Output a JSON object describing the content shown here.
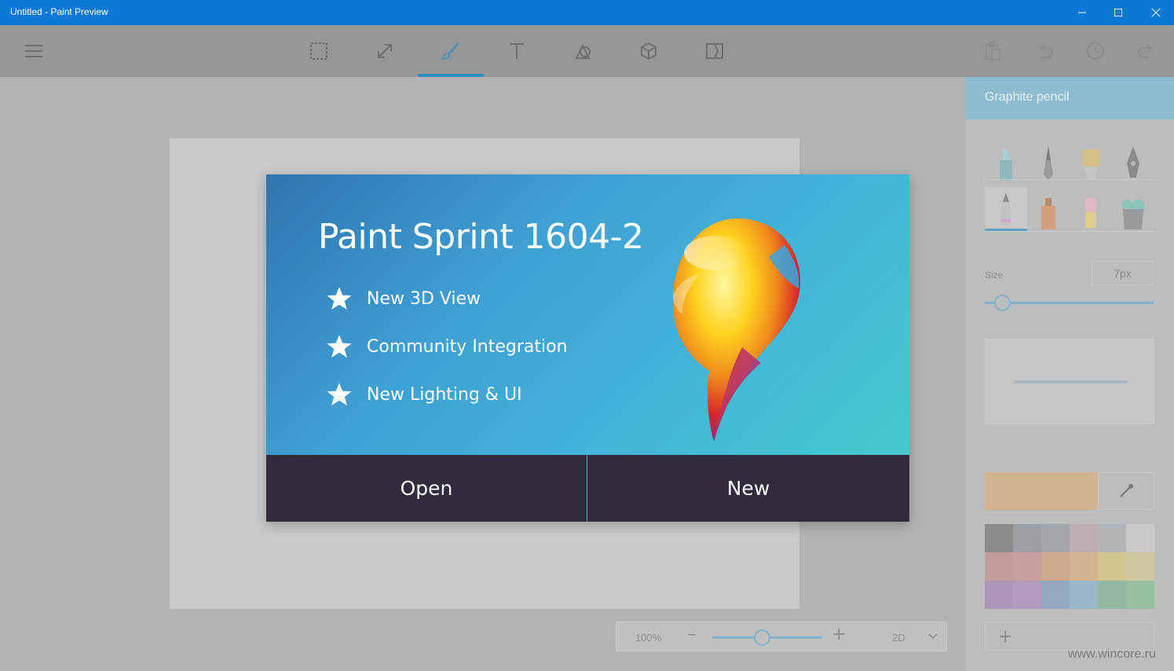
{
  "window": {
    "title": "Untitled - Paint Preview"
  },
  "toolbar": {
    "tools": [
      "select-tool",
      "crop-tool",
      "brushes-tool",
      "text-tool",
      "stickers-tool",
      "3d-objects-tool",
      "effects-tool"
    ],
    "active_tool": "brushes-tool"
  },
  "panel": {
    "title": "Graphite pencil",
    "size_label": "Size",
    "size_value": "7px",
    "size_level": 0.1,
    "current_color": "#d2b48e",
    "palette": [
      "#8b8b8b",
      "#9c9fa3",
      "#a3a6ab",
      "#bdaeb3",
      "#b2b6b9",
      "#c9c9c9",
      "#c69b9b",
      "#c99e9e",
      "#cdaa8c",
      "#d2b48e",
      "#d0c58f",
      "#cfc7a4",
      "#ad96b9",
      "#b59bc0",
      "#93a9bf",
      "#9cb6c9",
      "#93b9a3",
      "#97c09f"
    ]
  },
  "zoom": {
    "value": "100%",
    "level": 0.45,
    "mode": "2D"
  },
  "splash": {
    "title": "Paint Sprint 1604-2",
    "features": [
      "New 3D View",
      "Community Integration",
      "New Lighting & UI"
    ],
    "open_label": "Open",
    "new_label": "New"
  },
  "watermark": "www.wincore.ru",
  "colors": {
    "accent": "#0a78d4",
    "dialog_buttons": "#332a3e"
  }
}
